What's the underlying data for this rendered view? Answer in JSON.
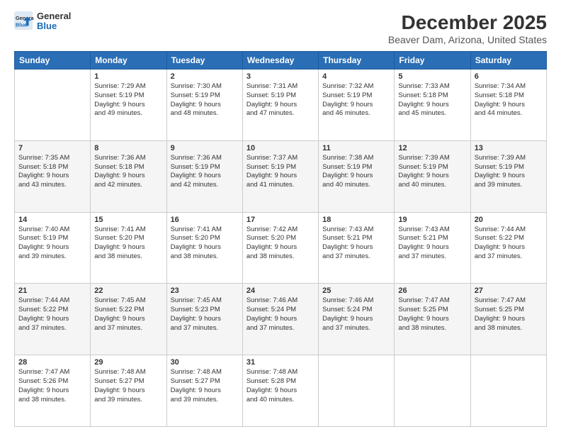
{
  "header": {
    "logo": {
      "line1": "General",
      "line2": "Blue"
    },
    "title": "December 2025",
    "subtitle": "Beaver Dam, Arizona, United States"
  },
  "calendar": {
    "days_of_week": [
      "Sunday",
      "Monday",
      "Tuesday",
      "Wednesday",
      "Thursday",
      "Friday",
      "Saturday"
    ],
    "weeks": [
      [
        {
          "day": "",
          "info": ""
        },
        {
          "day": "1",
          "info": "Sunrise: 7:29 AM\nSunset: 5:19 PM\nDaylight: 9 hours\nand 49 minutes."
        },
        {
          "day": "2",
          "info": "Sunrise: 7:30 AM\nSunset: 5:19 PM\nDaylight: 9 hours\nand 48 minutes."
        },
        {
          "day": "3",
          "info": "Sunrise: 7:31 AM\nSunset: 5:19 PM\nDaylight: 9 hours\nand 47 minutes."
        },
        {
          "day": "4",
          "info": "Sunrise: 7:32 AM\nSunset: 5:19 PM\nDaylight: 9 hours\nand 46 minutes."
        },
        {
          "day": "5",
          "info": "Sunrise: 7:33 AM\nSunset: 5:18 PM\nDaylight: 9 hours\nand 45 minutes."
        },
        {
          "day": "6",
          "info": "Sunrise: 7:34 AM\nSunset: 5:18 PM\nDaylight: 9 hours\nand 44 minutes."
        }
      ],
      [
        {
          "day": "7",
          "info": "Sunrise: 7:35 AM\nSunset: 5:18 PM\nDaylight: 9 hours\nand 43 minutes."
        },
        {
          "day": "8",
          "info": "Sunrise: 7:36 AM\nSunset: 5:18 PM\nDaylight: 9 hours\nand 42 minutes."
        },
        {
          "day": "9",
          "info": "Sunrise: 7:36 AM\nSunset: 5:19 PM\nDaylight: 9 hours\nand 42 minutes."
        },
        {
          "day": "10",
          "info": "Sunrise: 7:37 AM\nSunset: 5:19 PM\nDaylight: 9 hours\nand 41 minutes."
        },
        {
          "day": "11",
          "info": "Sunrise: 7:38 AM\nSunset: 5:19 PM\nDaylight: 9 hours\nand 40 minutes."
        },
        {
          "day": "12",
          "info": "Sunrise: 7:39 AM\nSunset: 5:19 PM\nDaylight: 9 hours\nand 40 minutes."
        },
        {
          "day": "13",
          "info": "Sunrise: 7:39 AM\nSunset: 5:19 PM\nDaylight: 9 hours\nand 39 minutes."
        }
      ],
      [
        {
          "day": "14",
          "info": "Sunrise: 7:40 AM\nSunset: 5:19 PM\nDaylight: 9 hours\nand 39 minutes."
        },
        {
          "day": "15",
          "info": "Sunrise: 7:41 AM\nSunset: 5:20 PM\nDaylight: 9 hours\nand 38 minutes."
        },
        {
          "day": "16",
          "info": "Sunrise: 7:41 AM\nSunset: 5:20 PM\nDaylight: 9 hours\nand 38 minutes."
        },
        {
          "day": "17",
          "info": "Sunrise: 7:42 AM\nSunset: 5:20 PM\nDaylight: 9 hours\nand 38 minutes."
        },
        {
          "day": "18",
          "info": "Sunrise: 7:43 AM\nSunset: 5:21 PM\nDaylight: 9 hours\nand 37 minutes."
        },
        {
          "day": "19",
          "info": "Sunrise: 7:43 AM\nSunset: 5:21 PM\nDaylight: 9 hours\nand 37 minutes."
        },
        {
          "day": "20",
          "info": "Sunrise: 7:44 AM\nSunset: 5:22 PM\nDaylight: 9 hours\nand 37 minutes."
        }
      ],
      [
        {
          "day": "21",
          "info": "Sunrise: 7:44 AM\nSunset: 5:22 PM\nDaylight: 9 hours\nand 37 minutes."
        },
        {
          "day": "22",
          "info": "Sunrise: 7:45 AM\nSunset: 5:22 PM\nDaylight: 9 hours\nand 37 minutes."
        },
        {
          "day": "23",
          "info": "Sunrise: 7:45 AM\nSunset: 5:23 PM\nDaylight: 9 hours\nand 37 minutes."
        },
        {
          "day": "24",
          "info": "Sunrise: 7:46 AM\nSunset: 5:24 PM\nDaylight: 9 hours\nand 37 minutes."
        },
        {
          "day": "25",
          "info": "Sunrise: 7:46 AM\nSunset: 5:24 PM\nDaylight: 9 hours\nand 37 minutes."
        },
        {
          "day": "26",
          "info": "Sunrise: 7:47 AM\nSunset: 5:25 PM\nDaylight: 9 hours\nand 38 minutes."
        },
        {
          "day": "27",
          "info": "Sunrise: 7:47 AM\nSunset: 5:25 PM\nDaylight: 9 hours\nand 38 minutes."
        }
      ],
      [
        {
          "day": "28",
          "info": "Sunrise: 7:47 AM\nSunset: 5:26 PM\nDaylight: 9 hours\nand 38 minutes."
        },
        {
          "day": "29",
          "info": "Sunrise: 7:48 AM\nSunset: 5:27 PM\nDaylight: 9 hours\nand 39 minutes."
        },
        {
          "day": "30",
          "info": "Sunrise: 7:48 AM\nSunset: 5:27 PM\nDaylight: 9 hours\nand 39 minutes."
        },
        {
          "day": "31",
          "info": "Sunrise: 7:48 AM\nSunset: 5:28 PM\nDaylight: 9 hours\nand 40 minutes."
        },
        {
          "day": "",
          "info": ""
        },
        {
          "day": "",
          "info": ""
        },
        {
          "day": "",
          "info": ""
        }
      ]
    ]
  }
}
